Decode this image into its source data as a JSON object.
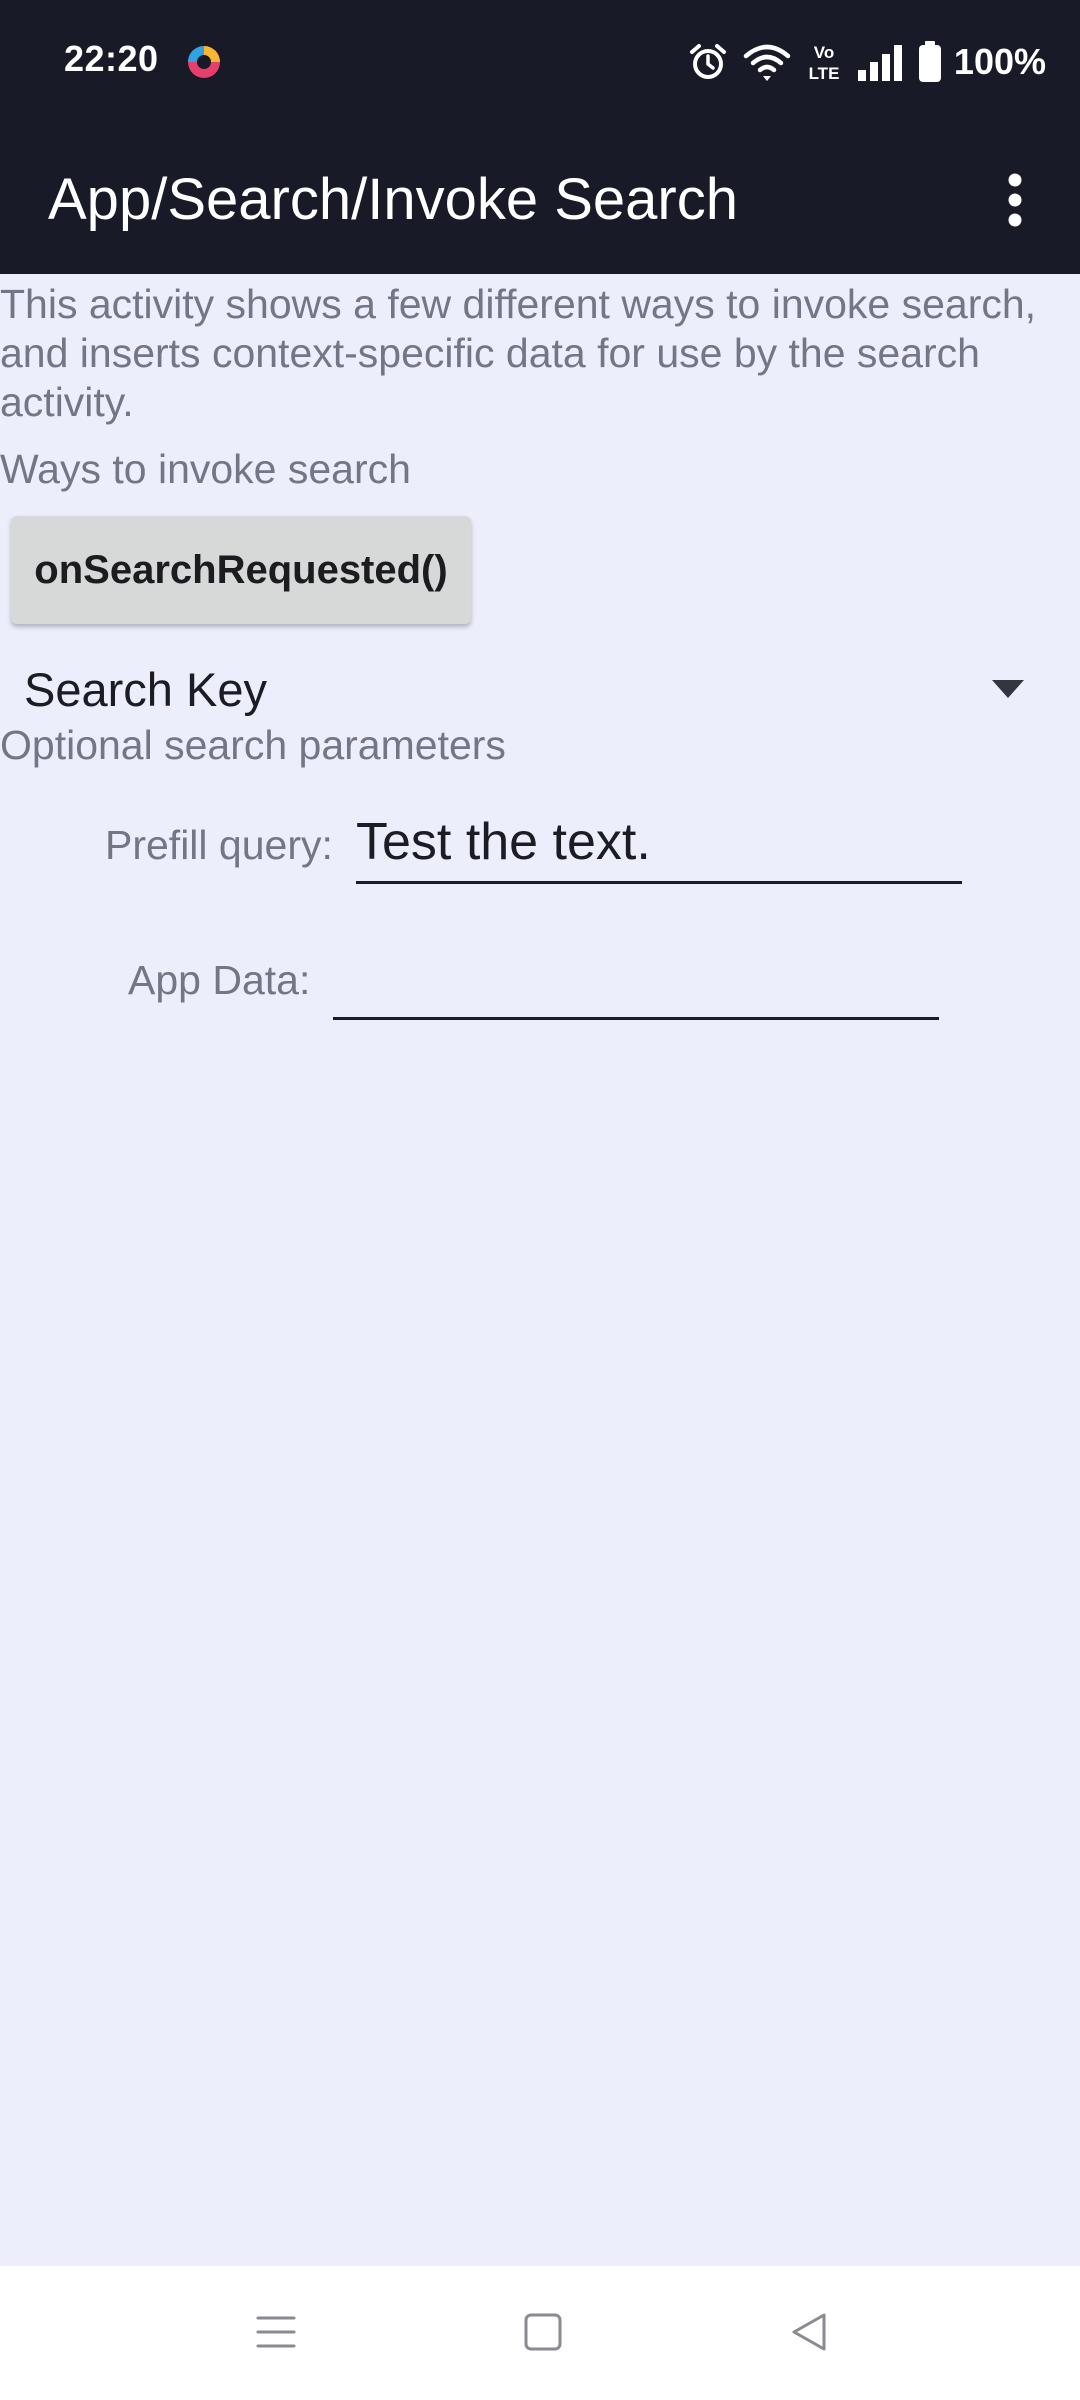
{
  "status_bar": {
    "time": "22:20",
    "battery_percent": "100%",
    "icons": [
      "app-logo-icon",
      "alarm-icon",
      "wifi-icon",
      "volte-icon",
      "signal-icon",
      "battery-icon"
    ],
    "network_badge_top": "Vo",
    "network_badge_bottom": "LTE"
  },
  "app_bar": {
    "title": "App/Search/Invoke Search",
    "overflow_icon": "more-vert-icon"
  },
  "content": {
    "description": "This activity shows a few different ways to invoke search, and inserts context-specific data for use by the search activity.",
    "ways_label": "Ways to invoke search",
    "search_button_label": "onSearchRequested()",
    "spinner_selected": "Search Key",
    "optional_label": "Optional search parameters",
    "prefill_label": "Prefill query:",
    "prefill_value": "Test the text.",
    "app_data_label": "App Data:",
    "app_data_value": ""
  },
  "nav_bar": {
    "icons": [
      "menu-icon",
      "home-icon",
      "back-icon"
    ]
  },
  "colors": {
    "bar_background": "#181a27",
    "page_background": "#eceefb",
    "secondary_text": "#737685",
    "button_background": "#d7d8d8"
  }
}
